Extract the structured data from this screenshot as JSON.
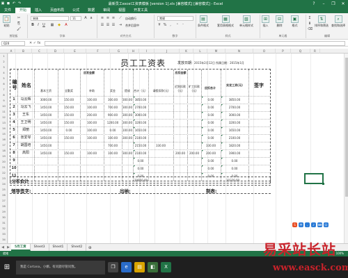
{
  "window": {
    "title": "最新员工excel工资表模板 [version 1].xls [兼容模式] [兼容模式] - Excel"
  },
  "menu": {
    "tabs": [
      "文件",
      "开始",
      "插入",
      "页面布局",
      "公式",
      "数据",
      "审阅",
      "视图",
      "开发工具"
    ],
    "active": 1
  },
  "ribbon": {
    "font_name": "宋体",
    "font_size": "11",
    "number_format": "常规",
    "wrap_text": "自动换行",
    "merge_center": "合并后居中",
    "conditional_format": "条件格式",
    "format_as_table": "套用表格格式",
    "cell_styles": "单元格样式",
    "insert": "插入",
    "delete": "删除",
    "format": "格式",
    "sort_filter": "排序和筛选",
    "find_select": "查找和选择",
    "paste": "粘贴",
    "groups": {
      "clipboard": "剪贴板",
      "font": "字体",
      "alignment": "对齐方式",
      "number": "数字",
      "styles": "样式",
      "cells": "单元格",
      "editing": "编辑"
    }
  },
  "formula_bar": {
    "name_box": "Q20",
    "fx": "fx",
    "value": ""
  },
  "columns": [
    "A",
    "B",
    "C",
    "D",
    "E",
    "F",
    "G",
    "H",
    "I",
    "J",
    "K",
    "L",
    "M",
    "N",
    "O",
    "P",
    "Q",
    "R"
  ],
  "rows": [
    "1",
    "2",
    "3",
    "4",
    "5",
    "6",
    "7",
    "8",
    "9",
    "10",
    "11",
    "12",
    "13",
    "14",
    "15",
    "16",
    "17",
    "18",
    "19",
    "20",
    "21",
    "22",
    "23",
    "24",
    "25",
    "26",
    "27",
    "28",
    "29",
    "30",
    "31",
    "32",
    "33",
    "34"
  ],
  "payroll": {
    "title": "员工工资表",
    "issue_label": "发放日期",
    "issue_date": "：2015年2月12日 所属日期：2015年1月",
    "headers": {
      "no": "编号",
      "name": "姓名",
      "payable_group": "应发金额",
      "deduction_group": "应扣金额",
      "base": "基本工资",
      "position": "全勤奖",
      "bonus": "补助",
      "overtime": "奖金",
      "allowance": "提成",
      "total": "合计（元）",
      "social": "请假扣款(元)",
      "late": "迟到扣款(元)",
      "absent": "旷工扣款(元)",
      "deduct_total": "应扣合计",
      "net": "实发工资(元)",
      "sign": "签字"
    },
    "rows": [
      {
        "no": "1",
        "name": "马云辉",
        "base": "3000.00",
        "pos": "150.00",
        "bonus": "100.00",
        "ot": "300.00",
        "allow": "300.00",
        "total": "3850.00",
        "social": "",
        "late": "",
        "absent": "",
        "dtotal": "0.00",
        "net": "3850.00"
      },
      {
        "no": "2",
        "name": "马云飞",
        "base": "1450.00",
        "pos": "150.00",
        "bonus": "100.00",
        "ot": "700.00",
        "allow": "300.00",
        "total": "2700.00",
        "social": "",
        "late": "",
        "absent": "",
        "dtotal": "0.00",
        "net": "2700.00"
      },
      {
        "no": "3",
        "name": "王东",
        "base": "1450.00",
        "pos": "150.00",
        "bonus": "200.00",
        "ot": "900.00",
        "allow": "300.00",
        "total": "3000.00",
        "social": "",
        "late": "",
        "absent": "",
        "dtotal": "0.00",
        "net": "3000.00"
      },
      {
        "no": "4",
        "name": "王卫明",
        "base": "1450.00",
        "pos": "150.00",
        "bonus": "100.00",
        "ot": "1200.00",
        "allow": "300.00",
        "total": "3200.00",
        "social": "",
        "late": "",
        "absent": "",
        "dtotal": "0.00",
        "net": "3200.00"
      },
      {
        "no": "5",
        "name": "郑丽",
        "base": "1450.00",
        "pos": "0.00",
        "bonus": "100.00",
        "ot": "0.00",
        "allow": "100.00",
        "total": "1650.00",
        "social": "",
        "late": "",
        "absent": "",
        "dtotal": "0.00",
        "net": "1650.00"
      },
      {
        "no": "6",
        "name": "张爱琴",
        "base": "1450.00",
        "pos": "150.00",
        "bonus": "100.00",
        "ot": "100.00",
        "allow": "300.00",
        "total": "2100.00",
        "social": "",
        "late": "",
        "absent": "",
        "dtotal": "0.00",
        "net": "2100.00"
      },
      {
        "no": "7",
        "name": "胡国培",
        "base": "1450.00",
        "pos": "",
        "bonus": "",
        "ot": "700.00",
        "allow": "",
        "total": "2150.00",
        "social": "330.00",
        "late": "",
        "absent": "",
        "dtotal": "330.00",
        "net": "1820.00"
      },
      {
        "no": "8",
        "name": "高阳",
        "base": "1450.00",
        "pos": "150.00",
        "bonus": "100.00",
        "ot": "100.00",
        "allow": "300.00",
        "total": "2100.00",
        "social": "",
        "late": "200.00",
        "absent": "200.00",
        "dtotal": "200.00",
        "net": "1900.00"
      },
      {
        "no": "9",
        "name": "",
        "base": "",
        "pos": "",
        "bonus": "",
        "ot": "",
        "allow": "",
        "total": "0.00",
        "social": "",
        "late": "",
        "absent": "",
        "dtotal": "0.00",
        "net": "0.00"
      },
      {
        "no": "10",
        "name": "",
        "base": "",
        "pos": "",
        "bonus": "",
        "ot": "",
        "allow": "",
        "total": "0.00",
        "social": "",
        "late": "",
        "absent": "",
        "dtotal": "0.00",
        "net": "0.00"
      },
      {
        "no": "11",
        "name": "",
        "base": "",
        "pos": "",
        "bonus": "",
        "ot": "",
        "allow": "",
        "total": "0.00",
        "social": "",
        "late": "",
        "absent": "",
        "dtotal": "0.00",
        "net": "0.00"
      }
    ],
    "subtotal_label": "分栏合计",
    "subtotal_total": "20850.00",
    "subtotal_net": "20320.00",
    "leader_sign": "领导签字:",
    "cashier": "出纳:",
    "preparer": "制表:"
  },
  "sheets": [
    "5月工资",
    "Sheet3",
    "Sheet1",
    "Sheet2"
  ],
  "active_sheet": 0,
  "status": {
    "ready": "就绪",
    "zoom": "100%"
  },
  "taskbar": {
    "cortana_placeholder": "我是 Cortana，小娜。有问题尽管问我。"
  },
  "watermark": {
    "line1": "易采站长站",
    "line2": "www.easck.com"
  }
}
